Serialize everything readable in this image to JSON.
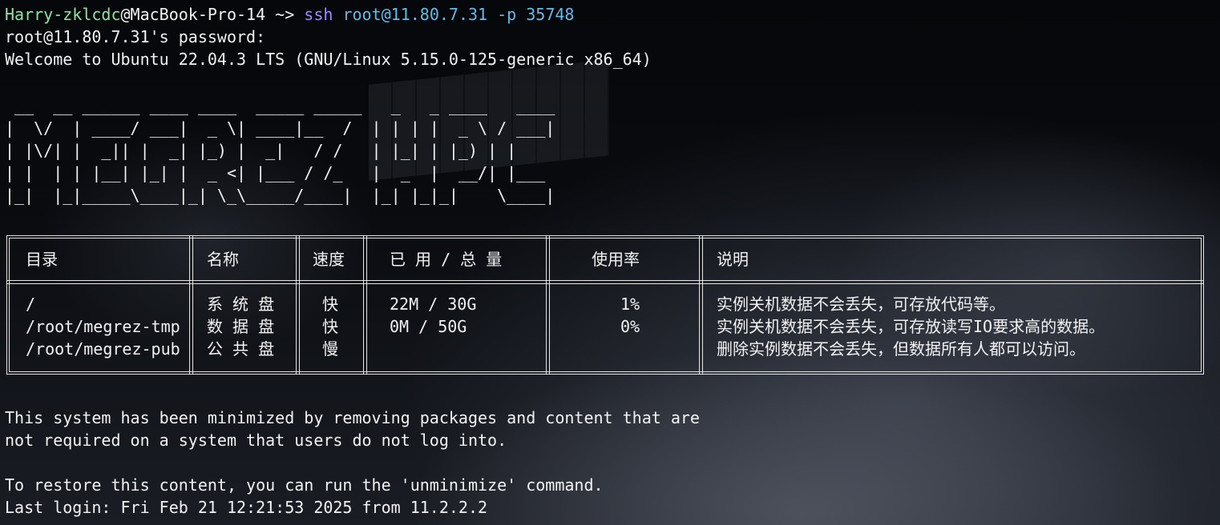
{
  "prompt": {
    "user_host": "Harry-zklcdc",
    "at_host": "@MacBook-Pro-14",
    "arrow": " ~> ",
    "command": "ssh",
    "args": " root@11.80.7.31 -p 35748"
  },
  "output": {
    "password_prompt": "root@11.80.7.31's password:",
    "welcome": "Welcome to Ubuntu 22.04.3 LTS (GNU/Linux 5.15.0-125-generic x86_64)",
    "banner": " __  __ ______ ____ ____  _____ _____   _   _ ____   ____ \n|  \\/  | ____/ ___|  _ \\| ____|__  /  | | | |  _ \\ / ___|\n| |\\/| |  _|| |  _| |_) |  _|   / /   | |_| | |_) | |    \n| |  | | |__| |_| |  _ <| |___ / /_   |  _  |  __/| |___ \n|_|  |_|_____\\____|_| \\_\\_____/____|  |_| |_|_|    \\____|",
    "minimized_1": "This system has been minimized by removing packages and content that are",
    "minimized_2": "not required on a system that users do not log into.",
    "restore": "To restore this content, you can run the 'unminimize' command.",
    "last_login": "Last login: Fri Feb 21 12:21:53 2025 from 11.2.2.2"
  },
  "table": {
    "headers": [
      "目录",
      "名称",
      "速度",
      "已 用 / 总 量",
      "使用率",
      "说明"
    ],
    "rows": [
      [
        "/",
        "系 统 盘",
        "快",
        "22M / 30G",
        "1%",
        "实例关机数据不会丢失，可存放代码等。"
      ],
      [
        "/root/megrez-tmp",
        "数 据 盘",
        "快",
        "0M / 50G",
        "0%",
        "实例关机数据不会丢失，可存放读写IO要求高的数据。"
      ],
      [
        "/root/megrez-pub",
        "公 共 盘",
        "慢",
        "",
        "",
        "删除实例数据不会丢失，但数据所有人都可以访问。"
      ]
    ]
  },
  "colors": {
    "prompt_user": "#8fe3a2",
    "command": "#9b8cff",
    "args": "#67b9e6",
    "text": "#f2f2f2"
  }
}
